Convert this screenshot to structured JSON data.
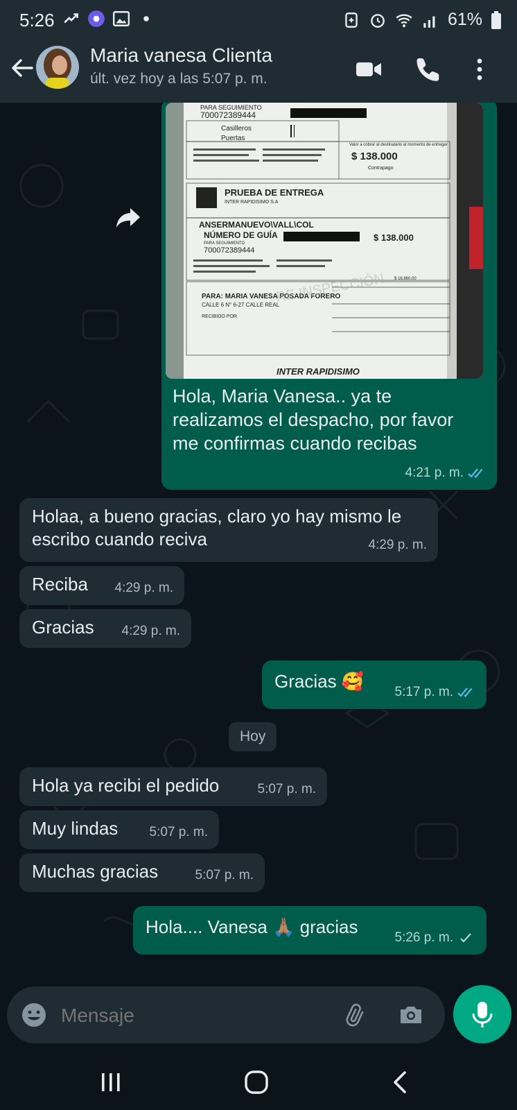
{
  "status_bar": {
    "time": "5:26",
    "battery": "61%"
  },
  "header": {
    "contact_name": "Maria vanesa Clienta",
    "last_seen": "últ. vez hoy a las 5:07 p. m."
  },
  "messages": [
    {
      "dir": "out",
      "type": "image-with-caption",
      "text": "Hola, Maria Vanesa.. ya te realizamos el despacho, por favor me confirmas cuando recibas",
      "time": "4:21 p. m.",
      "status": "read"
    },
    {
      "dir": "in",
      "text": "Holaa, a bueno gracias, claro yo hay mismo le escribo cuando reciva",
      "time": "4:29 p. m."
    },
    {
      "dir": "in",
      "text": "Reciba",
      "time": "4:29 p. m."
    },
    {
      "dir": "in",
      "text": "Gracias",
      "time": "4:29 p. m."
    },
    {
      "dir": "out",
      "text": "Gracias 🥰",
      "time": "5:17 p. m.",
      "status": "read"
    },
    {
      "dir": "in",
      "text": "Hola ya recibi el pedido",
      "time": "5:07 p. m."
    },
    {
      "dir": "in",
      "text": "Muy lindas",
      "time": "5:07 p. m."
    },
    {
      "dir": "in",
      "text": "Muchas gracias",
      "time": "5:07 p. m."
    },
    {
      "dir": "out",
      "text": "Hola.... Vanesa 🙏🏽 gracias",
      "time": "5:26 p. m.",
      "status": "sent"
    }
  ],
  "day_chip": "Hoy",
  "receipt": {
    "header_lines": [
      "PARA SEGUIMIENTO",
      "700072389444"
    ],
    "casilleros": "Casilleros",
    "puertas": "Puertas",
    "valor_label": "Valor a cobrar al destinatario al momento de entregar",
    "amount": "$ 138.000",
    "contrapago": "Contrapago",
    "title": "PRUEBA DE ENTREGA",
    "company": "INTER RAPIDISIMO S.A",
    "destination": "ANSERMANUEVO\\VALL\\COL",
    "guide_label": "NÚMERO DE GUÍA",
    "guide_sub": "PARA SEGUIMIENTO",
    "guide_number": "700072389444",
    "amount2": "$ 138.000",
    "amount_small": "$ 16.860,00",
    "recipient": "PARA: MARIA VANESA POSADA FORERO",
    "address": "CALLE 6 N° 6-27 CALLE REAL",
    "received": "RECIBIDO POR",
    "brand": "INTER RAPIDISIMO"
  },
  "input": {
    "placeholder": "Mensaje"
  },
  "colors": {
    "background": "#0b141a",
    "bar": "#1f2c34",
    "incoming": "#1f2c34",
    "outgoing": "#005c4b",
    "accent": "#00a884",
    "read_tick": "#53bdeb"
  }
}
